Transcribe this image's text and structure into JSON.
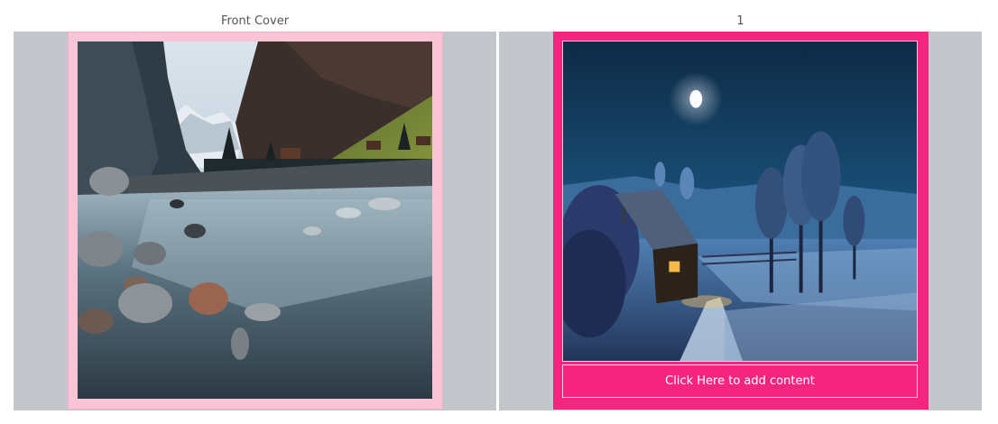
{
  "pages": [
    {
      "label": "Front Cover",
      "image": "mountain-river-photo",
      "frame_color": "#f9c4d6"
    },
    {
      "label": "1",
      "image": "night-cottage-photo",
      "frame_color": "#f5257f",
      "add_content_label": "Click Here to add content"
    }
  ],
  "colors": {
    "spread_background": "#c3c7cb",
    "accent": "#f5257f",
    "cover_frame": "#f9c4d6"
  }
}
